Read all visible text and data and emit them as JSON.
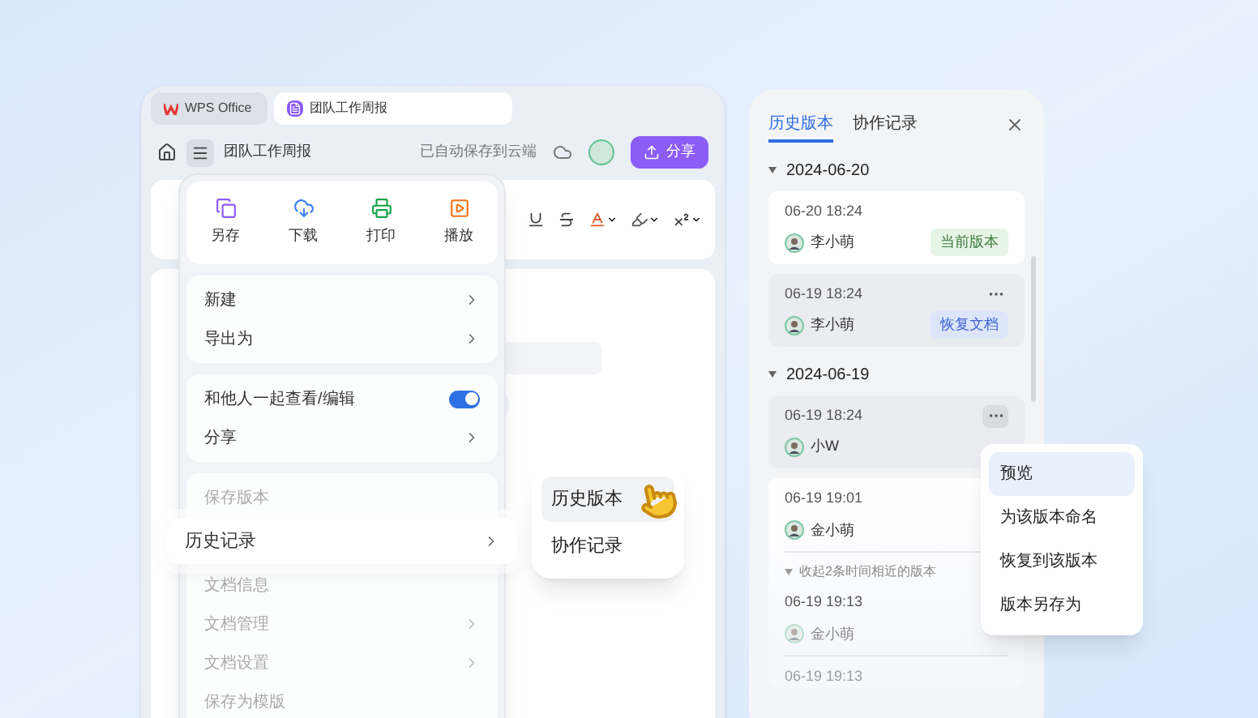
{
  "editor": {
    "tabs": [
      {
        "label": "WPS Office",
        "kind": "app",
        "selected": false
      },
      {
        "label": "团队工作周报",
        "kind": "doc",
        "selected": true
      }
    ],
    "doc_title": "团队工作周报",
    "save_status": "已自动保存到云端",
    "share_button": "分享"
  },
  "file_menu": {
    "actions": [
      {
        "label": "另存"
      },
      {
        "label": "下载"
      },
      {
        "label": "打印"
      },
      {
        "label": "播放"
      }
    ],
    "sections": [
      [
        {
          "label": "新建",
          "kind": "submenu",
          "selected": false,
          "dimmed": false
        },
        {
          "label": "导出为",
          "kind": "submenu",
          "selected": false,
          "dimmed": false
        }
      ],
      [
        {
          "label": "和他人一起查看/编辑",
          "kind": "toggle",
          "on": true,
          "selected": false,
          "dimmed": false
        },
        {
          "label": "分享",
          "kind": "submenu",
          "selected": false,
          "dimmed": false
        }
      ],
      [
        {
          "label": "保存版本",
          "kind": "plain",
          "selected": false,
          "dimmed": true
        },
        {
          "label": "历史记录",
          "kind": "submenu",
          "selected": true,
          "dimmed": false
        },
        {
          "label": "文档信息",
          "kind": "plain",
          "selected": false,
          "dimmed": true
        },
        {
          "label": "文档管理",
          "kind": "submenu",
          "selected": false,
          "dimmed": true
        },
        {
          "label": "文档设置",
          "kind": "submenu",
          "selected": false,
          "dimmed": true
        },
        {
          "label": "保存为模版",
          "kind": "plain",
          "selected": false,
          "dimmed": true
        }
      ]
    ]
  },
  "submenu": {
    "items": [
      {
        "label": "历史版本",
        "selected": true
      },
      {
        "label": "协作记录",
        "selected": false
      }
    ]
  },
  "history_panel": {
    "tabs": [
      {
        "label": "历史版本",
        "selected": true
      },
      {
        "label": "协作记录",
        "selected": false
      }
    ],
    "groups": [
      {
        "date": "2024-06-20",
        "expanded": true,
        "entries": [
          {
            "kind": "version",
            "time": "06-20 18:24",
            "user": "李小萌",
            "badge": {
              "label": "当前版本",
              "kind": "current"
            },
            "hovered": false,
            "menu_open": false
          },
          {
            "kind": "version",
            "time": "06-19 18:24",
            "user": "李小萌",
            "badge": {
              "label": "恢复文档",
              "kind": "restore"
            },
            "hovered": true,
            "menu_open": false
          }
        ]
      },
      {
        "date": "2024-06-19",
        "expanded": true,
        "entries": [
          {
            "kind": "version",
            "time": "06-19 18:24",
            "user": "小W",
            "hovered": true,
            "menu_open": true
          },
          {
            "kind": "cluster",
            "time": "06-19 19:01",
            "user": "金小萌",
            "collapse_label": "收起2条时间相近的版本",
            "expanded": true,
            "children": [
              {
                "time": "06-19 19:13",
                "user": "金小萌",
                "dimmed": false
              },
              {
                "time": "06-19 19:13",
                "dimmed": true
              }
            ]
          }
        ]
      }
    ]
  },
  "context_menu": {
    "items": [
      {
        "label": "预览",
        "selected": true
      },
      {
        "label": "为该版本命名",
        "selected": false
      },
      {
        "label": "恢复到该版本",
        "selected": false
      },
      {
        "label": "版本另存为",
        "selected": false
      }
    ]
  }
}
